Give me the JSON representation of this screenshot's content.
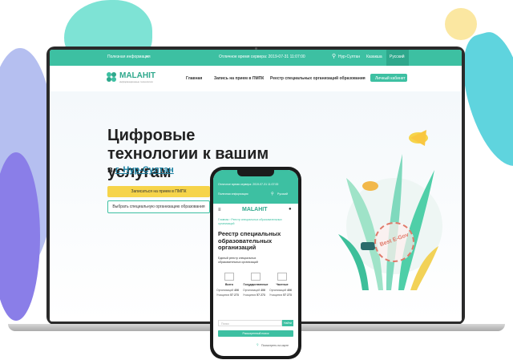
{
  "laptop": {
    "topbar": {
      "useful_info": "Полезная информация",
      "server_time": "Отличное время сервера: 2019-07-31 11:07:00",
      "city": "Нур-Султан",
      "lang_kz": "Казакша",
      "lang_ru": "Русский"
    },
    "nav": {
      "logo": "MALAHIT",
      "logo_sub": "информационные технологии",
      "home": "Главная",
      "signup": "Запись на прием в ПМПК",
      "registry": "Реестр специальных организаций образования",
      "cabinet": "Личный кабинет"
    },
    "hero": {
      "title": "Цифровые технологии к вашим услугам",
      "city_prefix": "в",
      "city": "г. Нур-Султан",
      "primary_button": "Записаться на прием в ПМПК",
      "secondary_button": "Выбрать специальную организацию образования"
    },
    "stamp": "Best E-Gov"
  },
  "phone": {
    "server_time": "Отличное время сервера: 2019-07-31 11:07:00",
    "useful_info": "Полезная информация",
    "lang": "Русский",
    "logo": "MALAHIT",
    "breadcrumb": "Главная › Реестр специальных образовательных организаций",
    "title": "Реестр специальных образовательных организаций",
    "subtitle": "Единый реестр специальных образовательных организаций",
    "stats": [
      {
        "label": "Всего",
        "orgs_label": "Организаций",
        "orgs": "406",
        "students_label": "Учащихся",
        "students": "57 273"
      },
      {
        "label": "Государственные",
        "orgs_label": "Организаций",
        "orgs": "406",
        "students_label": "Учащихся",
        "students": "57 273"
      },
      {
        "label": "Частные",
        "orgs_label": "Организаций",
        "orgs": "406",
        "students_label": "Учащихся",
        "students": "57 273"
      }
    ],
    "search_placeholder": "Поиск",
    "search_button": "Найти",
    "advanced_button": "Расширенный поиск",
    "map_link": "Посмотреть на карте"
  },
  "colors": {
    "accent": "#3dc0a2",
    "yellow": "#f6d44a",
    "dark": "#222222"
  }
}
